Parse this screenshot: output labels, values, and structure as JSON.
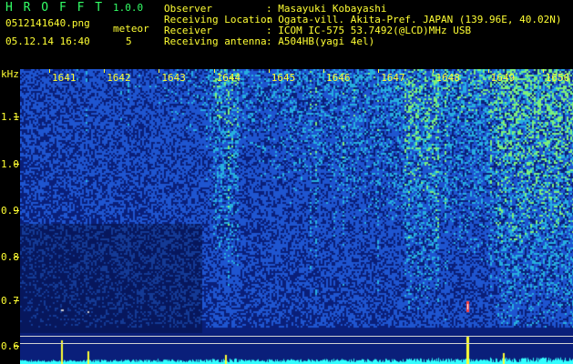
{
  "header": {
    "app_title": "H R O F F T",
    "version": "1.0.0",
    "filename": "0512141640.png",
    "datetime": "05.12.14 16:40",
    "meteor_label": "meteor",
    "meteor_count": "5",
    "info_labels": {
      "observer": "Observer",
      "location": "Receiving Location",
      "receiver": "Receiver",
      "antenna": "Receiving antenna"
    },
    "info_values": {
      "observer": ": Masayuki Kobayashi",
      "location": ": Ogata-vill. Akita-Pref. JAPAN (139.96E, 40.02N)",
      "receiver": ": ICOM IC-575 53.7492(@LCD)MHz USB",
      "antenna": ": A504HB(yagi 4el)"
    }
  },
  "spectrogram": {
    "y_unit": "kHz",
    "y_ticks": [
      "1.1",
      "1.0",
      "0.9",
      "0.8",
      "0.7",
      "0.6"
    ],
    "time_ticks": [
      "1641",
      "1642",
      "1643",
      "1644",
      "1645",
      "1646",
      "1647",
      "1648",
      "1649",
      "1650"
    ],
    "colors": {
      "background": "#0a1f7a",
      "noise_low": "#1e55d0",
      "noise_mid": "#26b0e0",
      "noise_high": "#7cf07c",
      "label": "#ffff33",
      "trace": "#33ffff"
    }
  }
}
